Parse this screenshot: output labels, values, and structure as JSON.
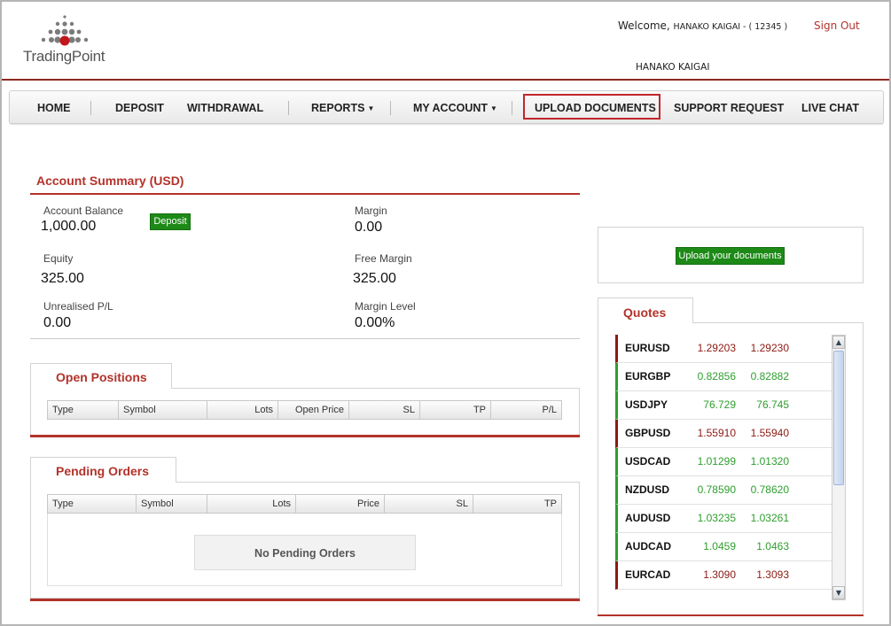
{
  "header": {
    "logo_text": "TradingPoint",
    "welcome_prefix": "Welcome,",
    "welcome_name": "HANAKO KAIGAI - ( 12345 )",
    "sign_out": "Sign Out",
    "username": "HANAKO KAIGAI"
  },
  "nav": {
    "items": [
      {
        "label": "HOME"
      },
      {
        "label": "DEPOSIT"
      },
      {
        "label": "WITHDRAWAL"
      },
      {
        "label": "REPORTS"
      },
      {
        "label": "MY ACCOUNT"
      },
      {
        "label": "UPLOAD DOCUMENTS"
      },
      {
        "label": "SUPPORT REQUEST"
      },
      {
        "label": "LIVE CHAT"
      }
    ],
    "active": "UPLOAD DOCUMENTS"
  },
  "summary": {
    "title": "Account Summary (USD)",
    "account_balance_label": "Account Balance",
    "account_balance": "1,000.00",
    "deposit_button": "Deposit",
    "margin_label": "Margin",
    "margin": "0.00",
    "equity_label": "Equity",
    "equity": "325.00",
    "free_margin_label": "Free Margin",
    "free_margin": "325.00",
    "unrealised_label": "Unrealised P/L",
    "unrealised": "0.00",
    "margin_level_label": "Margin Level",
    "margin_level": "0.00%"
  },
  "open_positions": {
    "title": "Open Positions",
    "columns": [
      "Type",
      "Symbol",
      "Lots",
      "Open Price",
      "SL",
      "TP",
      "P/L"
    ]
  },
  "pending_orders": {
    "title": "Pending Orders",
    "columns": [
      "Type",
      "Symbol",
      "Lots",
      "Price",
      "SL",
      "TP"
    ],
    "empty_message": "No Pending Orders"
  },
  "upload": {
    "button": "Upload your documents"
  },
  "quotes": {
    "title": "Quotes",
    "colors": {
      "up": "#2e9e2e",
      "down": "#8b1a12"
    },
    "rows": [
      {
        "symbol": "EURUSD",
        "bid": "1.29203",
        "ask": "1.29230",
        "trend": "down"
      },
      {
        "symbol": "EURGBP",
        "bid": "0.82856",
        "ask": "0.82882",
        "trend": "up"
      },
      {
        "symbol": "USDJPY",
        "bid": "76.729",
        "ask": "76.745",
        "trend": "up"
      },
      {
        "symbol": "GBPUSD",
        "bid": "1.55910",
        "ask": "1.55940",
        "trend": "down"
      },
      {
        "symbol": "USDCAD",
        "bid": "1.01299",
        "ask": "1.01320",
        "trend": "up"
      },
      {
        "symbol": "NZDUSD",
        "bid": "0.78590",
        "ask": "0.78620",
        "trend": "up"
      },
      {
        "symbol": "AUDUSD",
        "bid": "1.03235",
        "ask": "1.03261",
        "trend": "up"
      },
      {
        "symbol": "AUDCAD",
        "bid": "1.0459",
        "ask": "1.0463",
        "trend": "up"
      },
      {
        "symbol": "EURCAD",
        "bid": "1.3090",
        "ask": "1.3093",
        "trend": "down"
      }
    ]
  }
}
